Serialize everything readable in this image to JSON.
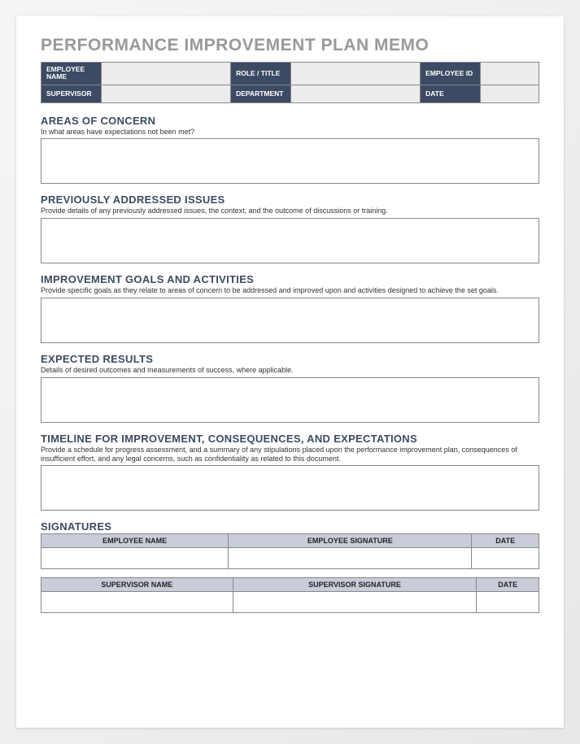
{
  "title": "PERFORMANCE IMPROVEMENT PLAN MEMO",
  "info": {
    "employee_name_label": "EMPLOYEE NAME",
    "role_title_label": "ROLE / TITLE",
    "employee_id_label": "EMPLOYEE ID",
    "supervisor_label": "SUPERVISOR",
    "department_label": "DEPARTMENT",
    "date_label": "DATE",
    "employee_name": "",
    "role_title": "",
    "employee_id": "",
    "supervisor": "",
    "department": "",
    "date": ""
  },
  "sections": {
    "areas": {
      "heading": "AREAS OF CONCERN",
      "subtext": "In what areas have expectations not been met?"
    },
    "previous": {
      "heading": "PREVIOUSLY ADDRESSED ISSUES",
      "subtext": "Provide details of any previously addressed issues, the context, and the outcome of discussions or training."
    },
    "goals": {
      "heading": "IMPROVEMENT GOALS AND ACTIVITIES",
      "subtext": "Provide specific goals as they relate to areas of concern to be addressed and improved upon and activities designed to achieve the set goals."
    },
    "results": {
      "heading": "EXPECTED RESULTS",
      "subtext": "Details of desired outcomes and measurements of success, where applicable."
    },
    "timeline": {
      "heading": "TIMELINE FOR IMPROVEMENT, CONSEQUENCES, AND EXPECTATIONS",
      "subtext": "Provide a schedule for progress assessment, and a summary of any stipulations placed upon the performance improvement plan, consequences of insufficient effort, and any legal concerns, such as confidentiality as related to this document."
    },
    "signatures": {
      "heading": "SIGNATURES",
      "emp_name": "EMPLOYEE NAME",
      "emp_sig": "EMPLOYEE SIGNATURE",
      "date": "DATE",
      "sup_name": "SUPERVISOR NAME",
      "sup_sig": "SUPERVISOR SIGNATURE"
    }
  }
}
